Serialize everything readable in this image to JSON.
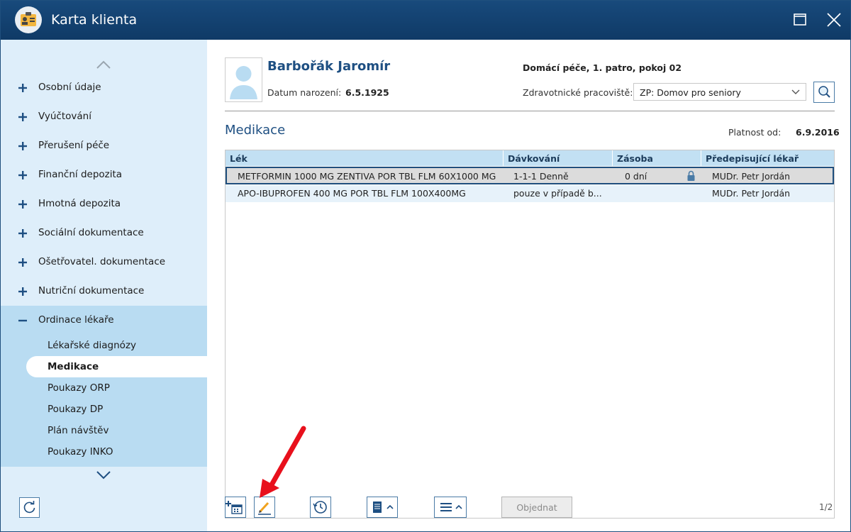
{
  "window": {
    "title": "Karta klienta"
  },
  "sidebar": {
    "items": [
      {
        "label": "Osobní údaje"
      },
      {
        "label": "Vyúčtování"
      },
      {
        "label": "Přerušení péče"
      },
      {
        "label": "Finanční depozita"
      },
      {
        "label": "Hmotná depozita"
      },
      {
        "label": "Sociální dokumentace"
      },
      {
        "label": "Ošetřovatel. dokumentace"
      },
      {
        "label": "Nutriční dokumentace"
      },
      {
        "label": "Ordinace lékaře"
      }
    ],
    "subitems": [
      {
        "label": "Lékařské diagnózy"
      },
      {
        "label": "Medikace"
      },
      {
        "label": "Poukazy ORP"
      },
      {
        "label": "Poukazy DP"
      },
      {
        "label": "Plán návštěv"
      },
      {
        "label": "Poukazy INKO"
      }
    ]
  },
  "client": {
    "name": "Barbořák Jaromír",
    "dob_label": "Datum narození:",
    "dob": "6.5.1925",
    "location": "Domácí péče, 1. patro, pokoj 02",
    "workplace_label": "Zdravotnické pracoviště:",
    "workplace": "ZP: Domov pro seniory"
  },
  "section": {
    "title": "Medikace",
    "valid_label": "Platnost od:",
    "valid_value": "6.9.2016"
  },
  "table": {
    "headers": [
      "Lék",
      "Dávkování",
      "Zásoba",
      "Předepisující lékař"
    ],
    "rows": [
      [
        "METFORMIN 1000 MG ZENTIVA POR TBL FLM 60X1000 MG",
        "1-1-1 Denně",
        "0 dní",
        "MUDr. Petr Jordán"
      ],
      [
        "APO-IBUPROFEN 400 MG POR TBL FLM 100X400MG",
        "pouze v případě b...",
        "",
        "MUDr. Petr Jordán"
      ]
    ]
  },
  "footer": {
    "order_label": "Objednat",
    "page": "1/2"
  },
  "colors": {
    "titlebar": "#184a7c",
    "sidebar": "#deeefa",
    "sidebar_expanded": "#b9dcf2",
    "accent": "#1e4f82",
    "annotation_arrow": "#e8101c"
  }
}
